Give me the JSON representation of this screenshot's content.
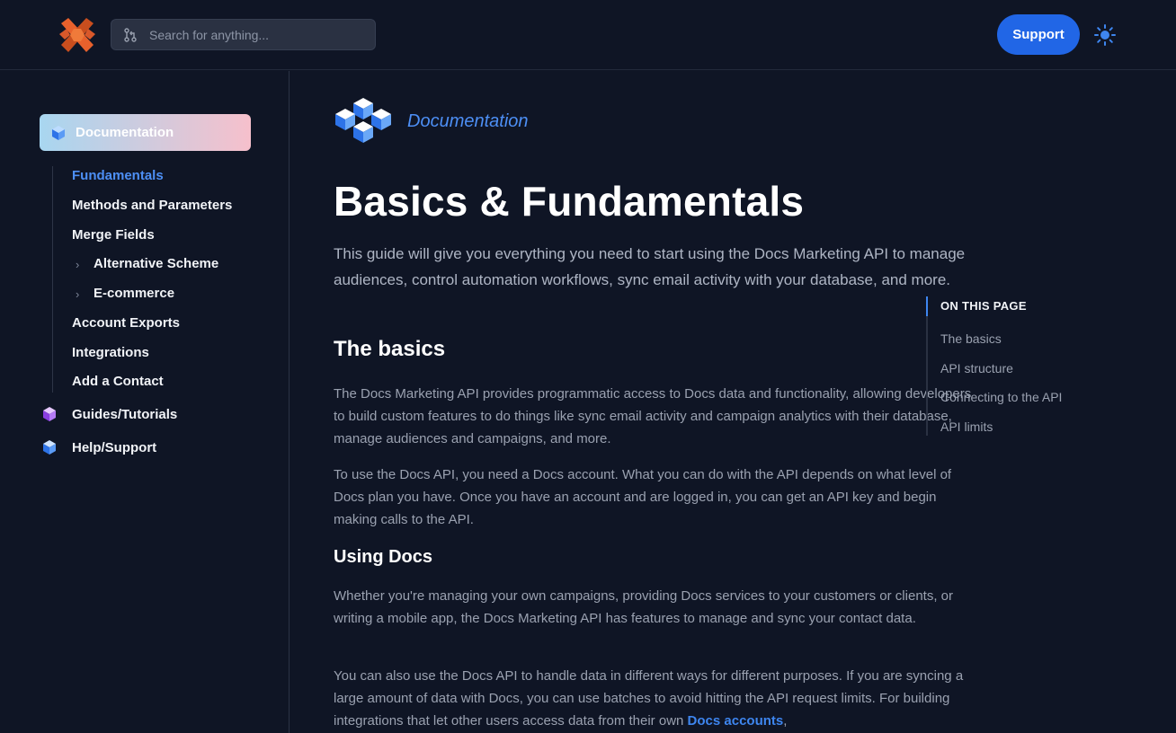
{
  "header": {
    "search_placeholder": "Search for anything...",
    "support_label": "Support"
  },
  "sidebar": {
    "active_section": "Documentation",
    "sub_items": [
      {
        "label": "Fundamentals",
        "active": true,
        "expandable": false
      },
      {
        "label": "Methods and Parameters",
        "active": false,
        "expandable": false
      },
      {
        "label": "Merge Fields",
        "active": false,
        "expandable": false
      },
      {
        "label": "Alternative Scheme",
        "active": false,
        "expandable": true
      },
      {
        "label": "E-commerce",
        "active": false,
        "expandable": true
      },
      {
        "label": "Account Exports",
        "active": false,
        "expandable": false
      },
      {
        "label": "Integrations",
        "active": false,
        "expandable": false
      },
      {
        "label": "Add a Contact",
        "active": false,
        "expandable": false
      }
    ],
    "sections": [
      {
        "label": "Guides/Tutorials",
        "icon": "purple-cube-icon"
      },
      {
        "label": "Help/Support",
        "icon": "blue-cube-icon"
      }
    ],
    "chevron": "›"
  },
  "main": {
    "eyebrow": "Documentation",
    "title": "Basics & Fundamentals",
    "lead": "This guide will give you everything you need to start using the Docs Marketing API to manage audiences, control automation workflows, sync email activity with your database, and more.",
    "basics_heading": "The basics",
    "basics_p1": "The Docs Marketing API provides programmatic access to Docs data and functionality, allowing developers to build custom features to do things like sync email activity and campaign analytics with their database, manage audiences and campaigns, and more.",
    "basics_p2": "To use the Docs API, you need a Docs account. What you can do with the API depends on what level of Docs plan you have. Once you have an account and are logged in, you can get an API key and begin making calls to the API.",
    "using_heading": "Using Docs",
    "using_p1": "Whether you're managing your own campaigns, providing Docs services to your customers or clients, or writing a mobile app, the Docs Marketing API has features to manage and sync your contact data.",
    "using_p2": "You can also use the Docs API to handle data in different ways for different purposes. If you are syncing a large amount of data with Docs, you can use batches to avoid hitting the API request limits. For building integrations that let other users access data from their own",
    "using_p2_link": "Docs accounts",
    "using_p2_tail": ","
  },
  "toc": {
    "title": "ON THIS PAGE",
    "items": [
      "The basics",
      "API structure",
      "Connecting to the API",
      "API limits"
    ]
  },
  "colors": {
    "background": "#0f1525",
    "accent": "#2166e6",
    "link": "#4d8ff5",
    "logo_orange": "#e8612c"
  }
}
